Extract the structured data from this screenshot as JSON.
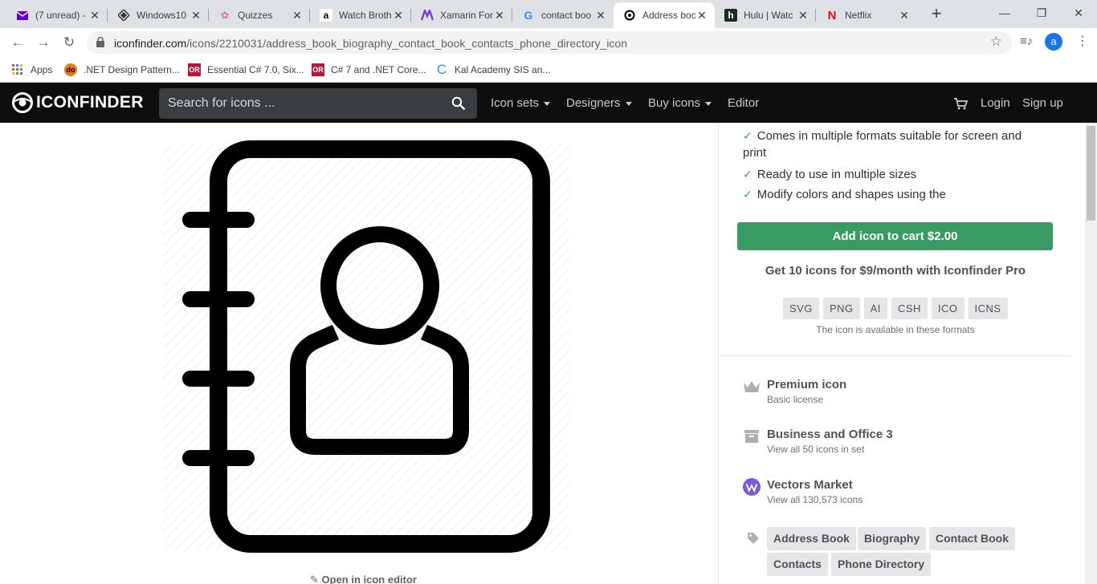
{
  "browser": {
    "tabs": [
      {
        "label": "(7 unread) -",
        "icon": "yahoo-mail-icon"
      },
      {
        "label": "Windows10",
        "icon": "windows-icon"
      },
      {
        "label": "Quizzes",
        "icon": "quizzes-icon"
      },
      {
        "label": "Watch Broth",
        "icon": "amazon-icon"
      },
      {
        "label": "Xamarin For",
        "icon": "xamarin-icon"
      },
      {
        "label": "contact boo",
        "icon": "google-icon"
      },
      {
        "label": "Address boo",
        "icon": "iconfinder-icon"
      },
      {
        "label": "Hulu | Watc",
        "icon": "hulu-icon"
      },
      {
        "label": "Netflix",
        "icon": "netflix-icon"
      }
    ],
    "url_domain": "iconfinder.com",
    "url_path": "/icons/2210031/address_book_biography_contact_book_contacts_phone_directory_icon",
    "profile_initial": "a",
    "bookmarks": [
      {
        "label": "Apps"
      },
      {
        "label": ".NET Design Pattern..."
      },
      {
        "label": "Essential C# 7.0, Six..."
      },
      {
        "label": "C# 7 and .NET Core..."
      },
      {
        "label": "Kal Academy SIS an..."
      }
    ]
  },
  "site": {
    "logo_text": "ICONFINDER",
    "search_placeholder": "Search for icons ...",
    "nav": {
      "icon_sets": "Icon sets",
      "designers": "Designers",
      "buy_icons": "Buy icons",
      "editor": "Editor",
      "login": "Login",
      "signup": "Sign up"
    }
  },
  "main": {
    "open_editor": "Open in icon editor"
  },
  "sidebar": {
    "features": [
      "Comes in multiple formats suitable for screen and",
      "print",
      "Ready to use in multiple sizes",
      "Modify colors and shapes using the"
    ],
    "cart_button": "Add icon to cart $2.00",
    "pro_offer": "Get 10 icons for $9/month with Iconfinder Pro",
    "formats": [
      "SVG",
      "PNG",
      "AI",
      "CSH",
      "ICO",
      "ICNS"
    ],
    "formats_note": "The icon is available in these formats",
    "license": {
      "title": "Premium icon",
      "sub": "Basic license"
    },
    "set": {
      "title": "Business and Office 3",
      "sub": "View all 50 icons in set"
    },
    "author": {
      "title": "Vectors Market",
      "sub": "View all 130,573 icons"
    },
    "tags": [
      "Address Book",
      "Biography",
      "Contact Book",
      "Contacts",
      "Phone Directory"
    ]
  },
  "colors": {
    "cart_green": "#3a9a63",
    "nav_black": "#0d0d0d",
    "tag_gray": "#e4e6e8"
  }
}
